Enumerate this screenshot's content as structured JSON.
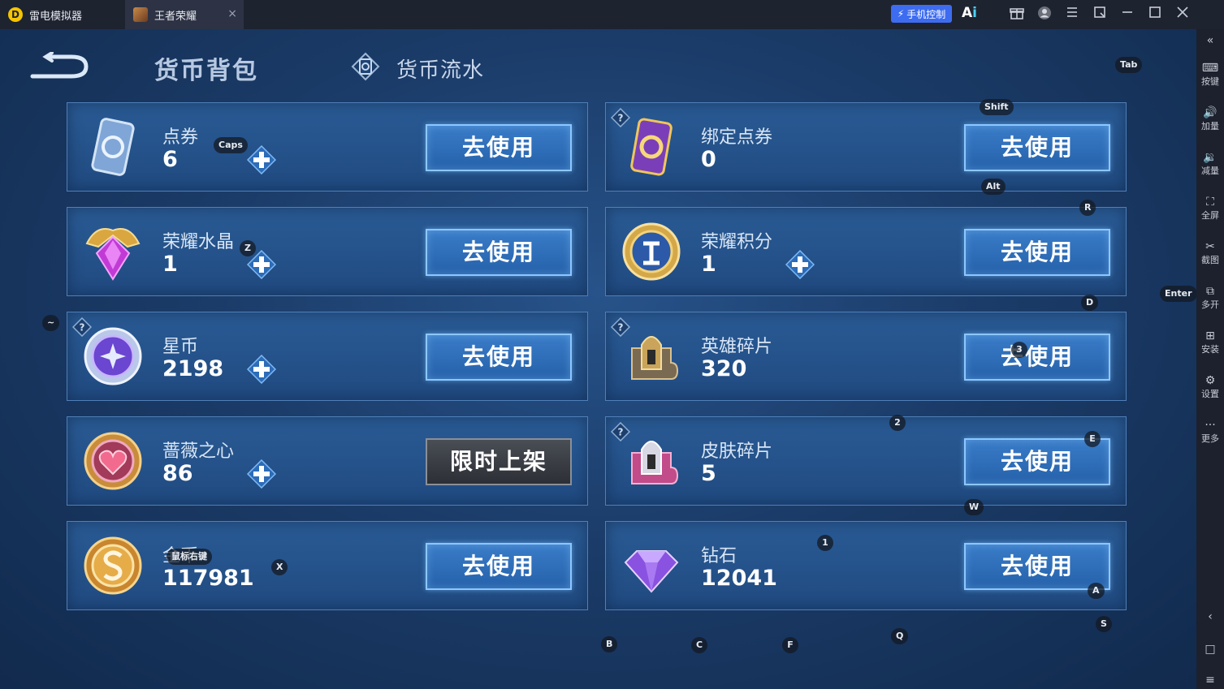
{
  "titlebar": {
    "app_name": "雷电模拟器",
    "game_tab": "王者荣耀",
    "close_glyph": "×",
    "phone_control": "手机控制",
    "ai_label": "A",
    "ai_suffix": "i"
  },
  "sidebar": {
    "items": [
      {
        "icon": "keyboard-icon",
        "glyph": "⌨",
        "label": "按键"
      },
      {
        "icon": "volume-up-icon",
        "glyph": "🔊",
        "label": "加量"
      },
      {
        "icon": "volume-down-icon",
        "glyph": "🔉",
        "label": "减量"
      },
      {
        "icon": "fullscreen-icon",
        "glyph": "⛶",
        "label": "全屏"
      },
      {
        "icon": "scissors-icon",
        "glyph": "✂",
        "label": "截图"
      },
      {
        "icon": "multi-instance-icon",
        "glyph": "⧉",
        "label": "多开"
      },
      {
        "icon": "install-icon",
        "glyph": "⊞",
        "label": "安装"
      },
      {
        "icon": "settings-icon",
        "glyph": "⚙",
        "label": "设置"
      },
      {
        "icon": "more-icon",
        "glyph": "···",
        "label": "更多"
      }
    ],
    "collapse_glyph": "«",
    "nav_back": "‹",
    "nav_home": "□",
    "nav_menu": "≡"
  },
  "header": {
    "active_tab": "货币背包",
    "flow_tab": "货币流水"
  },
  "cards": [
    {
      "name": "点券",
      "amount": "6",
      "button": "去使用",
      "icon": "coupon-card-icon",
      "plus": true,
      "help": false,
      "limited": false
    },
    {
      "name": "绑定点券",
      "amount": "0",
      "button": "去使用",
      "icon": "bound-coupon-card-icon",
      "plus": false,
      "help": true,
      "limited": false
    },
    {
      "name": "荣耀水晶",
      "amount": "1",
      "button": "去使用",
      "icon": "glory-crystal-icon",
      "plus": true,
      "help": false,
      "limited": false
    },
    {
      "name": "荣耀积分",
      "amount": "1",
      "button": "去使用",
      "icon": "glory-points-icon",
      "plus": true,
      "help": false,
      "limited": false
    },
    {
      "name": "星币",
      "amount": "2198",
      "button": "去使用",
      "icon": "star-coin-icon",
      "plus": true,
      "help": true,
      "limited": false
    },
    {
      "name": "英雄碎片",
      "amount": "320",
      "button": "去使用",
      "icon": "hero-fragment-icon",
      "plus": false,
      "help": true,
      "limited": false
    },
    {
      "name": "蔷薇之心",
      "amount": "86",
      "button": "限时上架",
      "icon": "rose-heart-icon",
      "plus": true,
      "help": false,
      "limited": true
    },
    {
      "name": "皮肤碎片",
      "amount": "5",
      "button": "去使用",
      "icon": "skin-fragment-icon",
      "plus": false,
      "help": true,
      "limited": false
    },
    {
      "name": "金币",
      "amount": "117981",
      "button": "去使用",
      "icon": "gold-coin-icon",
      "plus": false,
      "help": false,
      "limited": false
    },
    {
      "name": "钻石",
      "amount": "12041",
      "button": "去使用",
      "icon": "diamond-icon",
      "plus": false,
      "help": false,
      "limited": false
    }
  ],
  "keymap": [
    {
      "label": "Tab"
    },
    {
      "label": "Shift"
    },
    {
      "label": "Caps"
    },
    {
      "label": "Alt"
    },
    {
      "label": "R"
    },
    {
      "label": "Z"
    },
    {
      "label": "Enter"
    },
    {
      "label": "D"
    },
    {
      "label": "~"
    },
    {
      "label": "3"
    },
    {
      "label": "2"
    },
    {
      "label": "E"
    },
    {
      "label": "W"
    },
    {
      "label": "1"
    },
    {
      "label": "鼠标右键"
    },
    {
      "label": "X"
    },
    {
      "label": "A"
    },
    {
      "label": "S"
    },
    {
      "label": "Q"
    },
    {
      "label": "B"
    },
    {
      "label": "C"
    },
    {
      "label": "F"
    }
  ]
}
